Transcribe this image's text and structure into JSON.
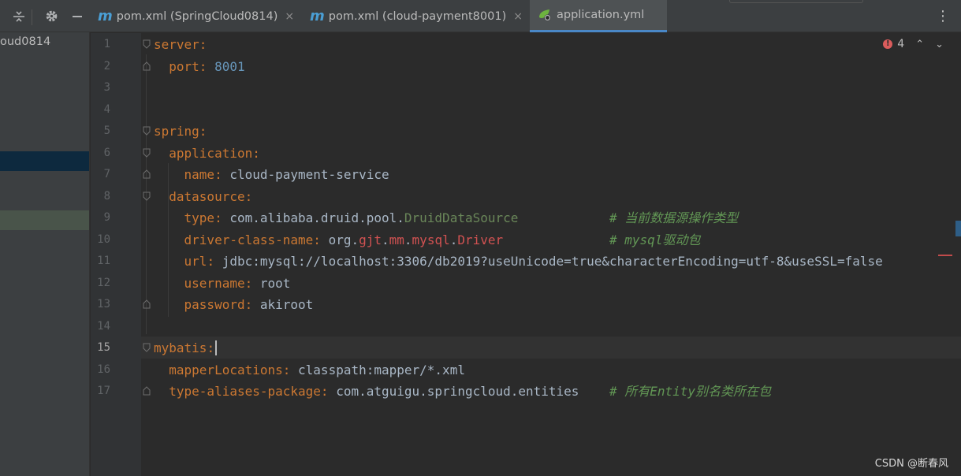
{
  "tabs": [
    {
      "icon_text": "m",
      "label": "pom.xml (SpringCloud0814)",
      "close": "×"
    },
    {
      "icon_text": "m",
      "label": "pom.xml (cloud-payment8001)",
      "close": "×"
    },
    {
      "label": "application.yml"
    }
  ],
  "toolbar": {
    "collapse_icon": "collapse-all-icon",
    "settings_icon": "gear-icon",
    "hide_icon": "minimize-icon",
    "menu": "⋮"
  },
  "project": {
    "label": "oud0814"
  },
  "inspection": {
    "count": "4",
    "badge": "!",
    "prev": "⌃",
    "next": "⌄"
  },
  "lines": [
    {
      "num": "1",
      "tokens": [
        {
          "t": "server",
          "c": "k"
        },
        {
          "t": ":",
          "c": "p"
        }
      ]
    },
    {
      "num": "2",
      "tokens": [
        {
          "t": "  "
        },
        {
          "t": "port",
          "c": "k"
        },
        {
          "t": ": ",
          "c": "p"
        },
        {
          "t": "8001",
          "c": "n"
        }
      ]
    },
    {
      "num": "3",
      "tokens": []
    },
    {
      "num": "4",
      "tokens": []
    },
    {
      "num": "5",
      "tokens": [
        {
          "t": "spring",
          "c": "k"
        },
        {
          "t": ":",
          "c": "p"
        }
      ]
    },
    {
      "num": "6",
      "tokens": [
        {
          "t": "  "
        },
        {
          "t": "application",
          "c": "k"
        },
        {
          "t": ":",
          "c": "p"
        }
      ]
    },
    {
      "num": "7",
      "tokens": [
        {
          "t": "    "
        },
        {
          "t": "name",
          "c": "k"
        },
        {
          "t": ": ",
          "c": "p"
        },
        {
          "t": "cloud-payment-service",
          "c": "v"
        }
      ]
    },
    {
      "num": "8",
      "tokens": [
        {
          "t": "  "
        },
        {
          "t": "datasource",
          "c": "k"
        },
        {
          "t": ":",
          "c": "p"
        }
      ]
    },
    {
      "num": "9",
      "tokens": [
        {
          "t": "    "
        },
        {
          "t": "type",
          "c": "k"
        },
        {
          "t": ": ",
          "c": "p"
        },
        {
          "t": "com.alibaba.druid.pool.",
          "c": "v"
        },
        {
          "t": "DruidDataSource",
          "c": "cls"
        },
        {
          "t": "            "
        },
        {
          "t": "# 当前数据源操作类型",
          "c": "c"
        }
      ]
    },
    {
      "num": "10",
      "tokens": [
        {
          "t": "    "
        },
        {
          "t": "driver-class-name",
          "c": "k"
        },
        {
          "t": ": ",
          "c": "p"
        },
        {
          "t": "org.",
          "c": "v"
        },
        {
          "t": "gjt",
          "c": "red"
        },
        {
          "t": ".",
          "c": "v"
        },
        {
          "t": "mm",
          "c": "red"
        },
        {
          "t": ".",
          "c": "v"
        },
        {
          "t": "mysql",
          "c": "red"
        },
        {
          "t": ".",
          "c": "v"
        },
        {
          "t": "Driver",
          "c": "red"
        },
        {
          "t": "              "
        },
        {
          "t": "# mysql驱动包",
          "c": "c"
        }
      ]
    },
    {
      "num": "11",
      "tokens": [
        {
          "t": "    "
        },
        {
          "t": "url",
          "c": "k"
        },
        {
          "t": ": ",
          "c": "p"
        },
        {
          "t": "jdbc:mysql://localhost:3306/db2019?useUnicode=true&characterEncoding=utf-8&useSSL=false",
          "c": "v"
        }
      ]
    },
    {
      "num": "12",
      "tokens": [
        {
          "t": "    "
        },
        {
          "t": "username",
          "c": "k"
        },
        {
          "t": ": ",
          "c": "p"
        },
        {
          "t": "root",
          "c": "v"
        }
      ]
    },
    {
      "num": "13",
      "tokens": [
        {
          "t": "    "
        },
        {
          "t": "password",
          "c": "k"
        },
        {
          "t": ": ",
          "c": "p"
        },
        {
          "t": "akiroot",
          "c": "v"
        }
      ]
    },
    {
      "num": "14",
      "tokens": []
    },
    {
      "num": "15",
      "tokens": [
        {
          "t": "mybatis",
          "c": "k"
        },
        {
          "t": ":",
          "c": "p"
        }
      ]
    },
    {
      "num": "16",
      "tokens": [
        {
          "t": "  "
        },
        {
          "t": "mapperLocations",
          "c": "k"
        },
        {
          "t": ": ",
          "c": "p"
        },
        {
          "t": "classpath:mapper/*.xml",
          "c": "v"
        }
      ]
    },
    {
      "num": "17",
      "tokens": [
        {
          "t": "  "
        },
        {
          "t": "type-aliases-package",
          "c": "k"
        },
        {
          "t": ": ",
          "c": "p"
        },
        {
          "t": "com.atguigu.springcloud.entities",
          "c": "v"
        },
        {
          "t": "    "
        },
        {
          "t": "# 所有Entity别名类所在包",
          "c": "c"
        }
      ]
    }
  ],
  "watermark": "CSDN @断春风",
  "colors": {
    "key": "#cc7832",
    "number": "#6897bb",
    "comment": "#629755",
    "error": "#d25252",
    "accent": "#4a88c7"
  }
}
